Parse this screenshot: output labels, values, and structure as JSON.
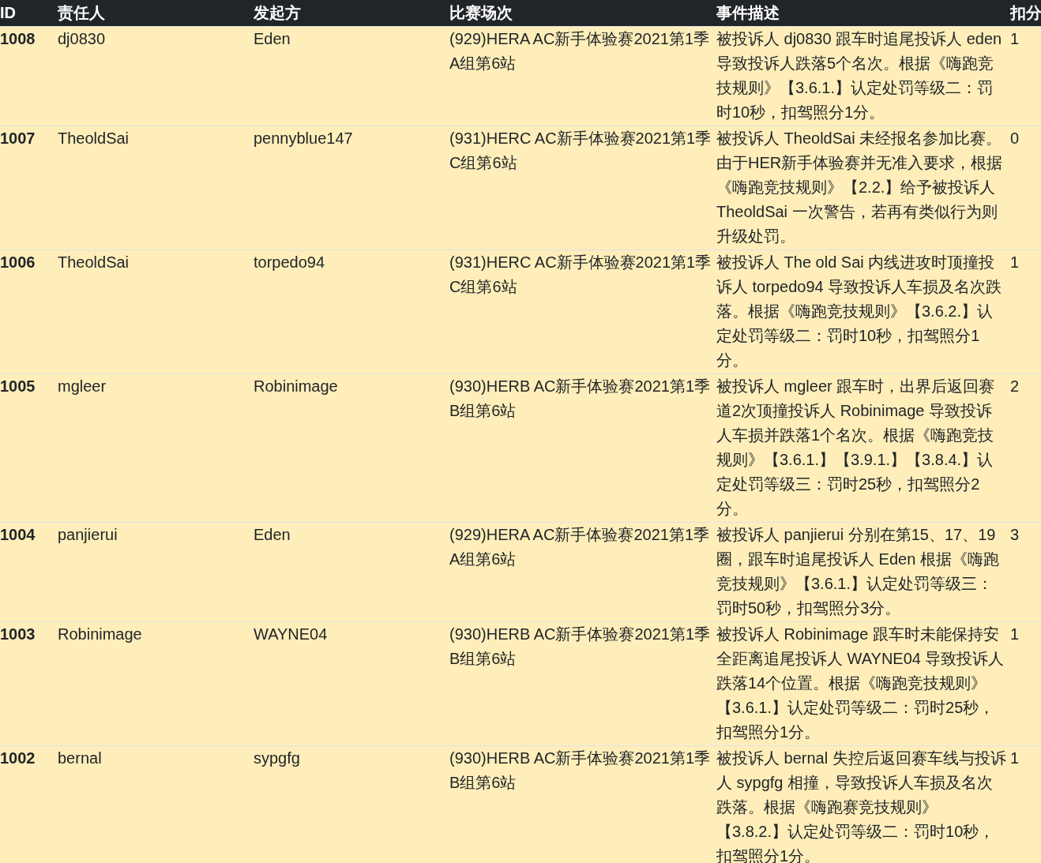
{
  "table": {
    "columns": [
      "ID",
      "责任人",
      "发起方",
      "比赛场次",
      "事件描述",
      "扣分"
    ],
    "rows": [
      {
        "id": "1008",
        "responsible": "dj0830",
        "initiator": "Eden",
        "match": "(929)HERA AC新手体验赛2021第1季A组第6站",
        "description": "被投诉人 dj0830 跟车时追尾投诉人 eden 导致投诉人跌落5个名次。根据《嗨跑竞技规则》【3.6.1.】认定处罚等级二：罚时10秒，扣驾照分1分。",
        "points": "1"
      },
      {
        "id": "1007",
        "responsible": "TheoldSai",
        "initiator": "pennyblue147",
        "match": "(931)HERC AC新手体验赛2021第1季C组第6站",
        "description": "被投诉人 TheoldSai 未经报名参加比赛。由于HER新手体验赛并无准入要求，根据《嗨跑竞技规则》【2.2.】给予被投诉人 TheoldSai 一次警告，若再有类似行为则升级处罚。",
        "points": "0"
      },
      {
        "id": "1006",
        "responsible": "TheoldSai",
        "initiator": "torpedo94",
        "match": "(931)HERC AC新手体验赛2021第1季C组第6站",
        "description": "被投诉人 The old Sai 内线进攻时顶撞投诉人 torpedo94 导致投诉人车损及名次跌落。根据《嗨跑竞技规则》【3.6.2.】认定处罚等级二：罚时10秒，扣驾照分1分。",
        "points": "1"
      },
      {
        "id": "1005",
        "responsible": "mgleer",
        "initiator": "Robinimage",
        "match": "(930)HERB AC新手体验赛2021第1季B组第6站",
        "description": "被投诉人 mgleer 跟车时，出界后返回赛道2次顶撞投诉人 Robinimage 导致投诉人车损并跌落1个名次。根据《嗨跑竞技规则》【3.6.1.】【3.9.1.】【3.8.4.】认定处罚等级三：罚时25秒，扣驾照分2分。",
        "points": "2"
      },
      {
        "id": "1004",
        "responsible": "panjierui",
        "initiator": "Eden",
        "match": "(929)HERA AC新手体验赛2021第1季A组第6站",
        "description": "被投诉人 panjierui 分别在第15、17、19圈，跟车时追尾投诉人 Eden 根据《嗨跑竞技规则》【3.6.1.】认定处罚等级三：罚时50秒，扣驾照分3分。",
        "points": "3"
      },
      {
        "id": "1003",
        "responsible": "Robinimage",
        "initiator": "WAYNE04",
        "match": "(930)HERB AC新手体验赛2021第1季B组第6站",
        "description": "被投诉人 Robinimage 跟车时未能保持安全距离追尾投诉人 WAYNE04 导致投诉人跌落14个位置。根据《嗨跑竞技规则》【3.6.1.】认定处罚等级二：罚时25秒，扣驾照分1分。",
        "points": "1"
      },
      {
        "id": "1002",
        "responsible": "bernal",
        "initiator": "sypgfg",
        "match": "(930)HERB AC新手体验赛2021第1季B组第6站",
        "description": "被投诉人 bernal 失控后返回赛车线与投诉人 sypgfg 相撞，导致投诉人车损及名次跌落。根据《嗨跑赛竞技规则》【3.8.2.】认定处罚等级二：罚时10秒，扣驾照分1分。",
        "points": "1"
      }
    ]
  }
}
